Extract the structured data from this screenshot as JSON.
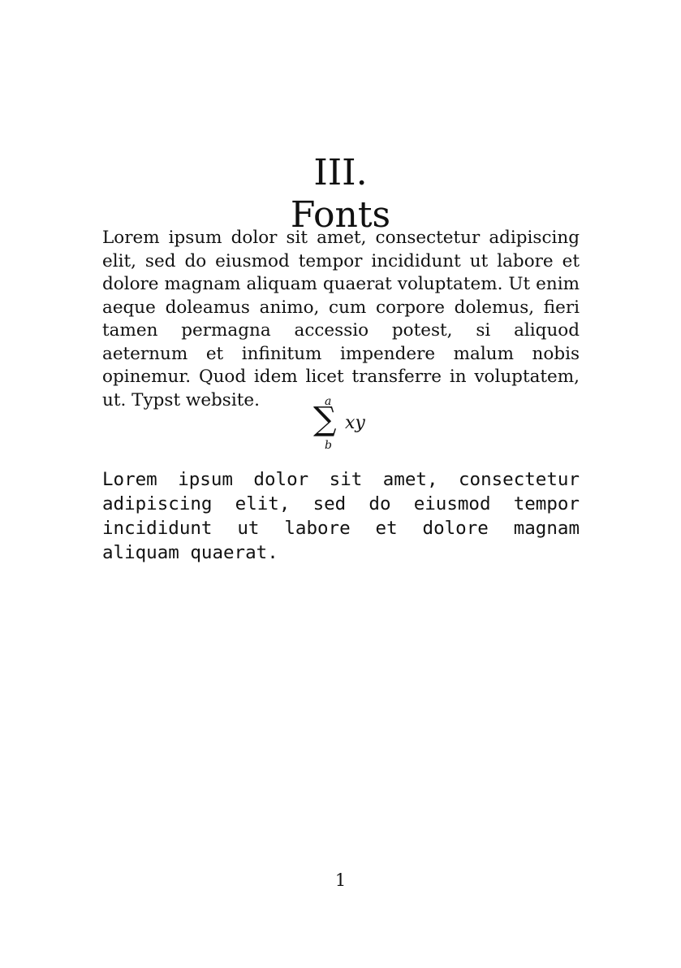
{
  "heading": {
    "number": "III.",
    "title": "Fonts"
  },
  "body": {
    "paragraph": "Lorem ipsum dolor sit amet, consectetur adipiscing elit, sed do eiusmod tempor incididunt ut labore et dolore magnam aliquam quaerat voluptatem. Ut enim aeque doleamus animo, cum corpore dolemus, fieri tamen permagna accessio potest, si aliquod aeternum et infinitum impendere malum nobis opinemur. Quod idem licet transferre in voluptatem, ut. Typst website."
  },
  "equation": {
    "operator": "∑",
    "upper": "a",
    "lower": "b",
    "body": "xy"
  },
  "mono": {
    "paragraph": "Lorem ipsum dolor sit amet, consectetur adipiscing elit, sed do eiusmod tempor incididunt ut labore et dolore magnam aliquam quaerat."
  },
  "footer": {
    "page_number": "1"
  }
}
